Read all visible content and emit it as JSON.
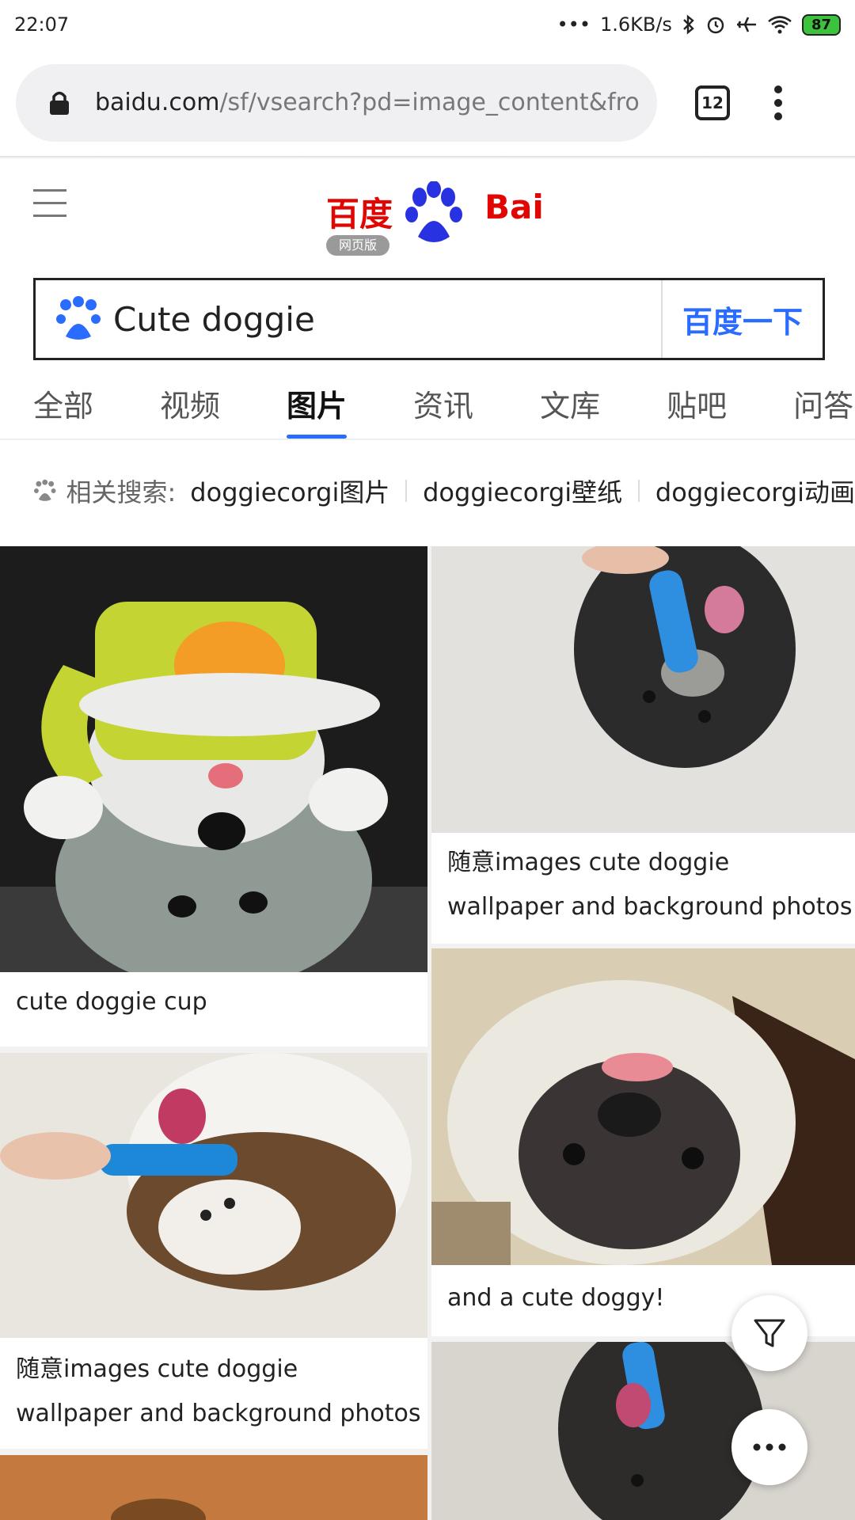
{
  "status": {
    "time": "22:07",
    "dots": "•••",
    "speed": "1.6KB/s",
    "battery": "87"
  },
  "browser": {
    "url_host": "baidu.com",
    "url_path": "/sf/vsearch?pd=image_content&fro",
    "tab_count": "12"
  },
  "search": {
    "query": "Cute doggie",
    "button_label": "百度一下"
  },
  "nav_tabs": [
    {
      "label": "全部"
    },
    {
      "label": "视频"
    },
    {
      "label": "图片"
    },
    {
      "label": "资讯"
    },
    {
      "label": "文库"
    },
    {
      "label": "贴吧"
    },
    {
      "label": "问答"
    }
  ],
  "related": {
    "label": "相关搜索:",
    "items": [
      "doggiecorgi图片",
      "doggiecorgi壁纸",
      "doggiecorgi动画"
    ]
  },
  "results": [
    {
      "caption_line1": "cute   doggie  cup",
      "caption_line2": ""
    },
    {
      "caption_line1": "随意images  cute   doggie",
      "caption_line2": "wallpaper and background photos"
    },
    {
      "caption_line1": "随意images  cute   doggie",
      "caption_line2": "wallpaper and background photos"
    },
    {
      "caption_line1": "and a  cute  doggy!",
      "caption_line2": ""
    }
  ],
  "colors": {
    "accent": "#2a6cff",
    "brand_red": "#e10601",
    "battery_green": "#3cc23c"
  }
}
